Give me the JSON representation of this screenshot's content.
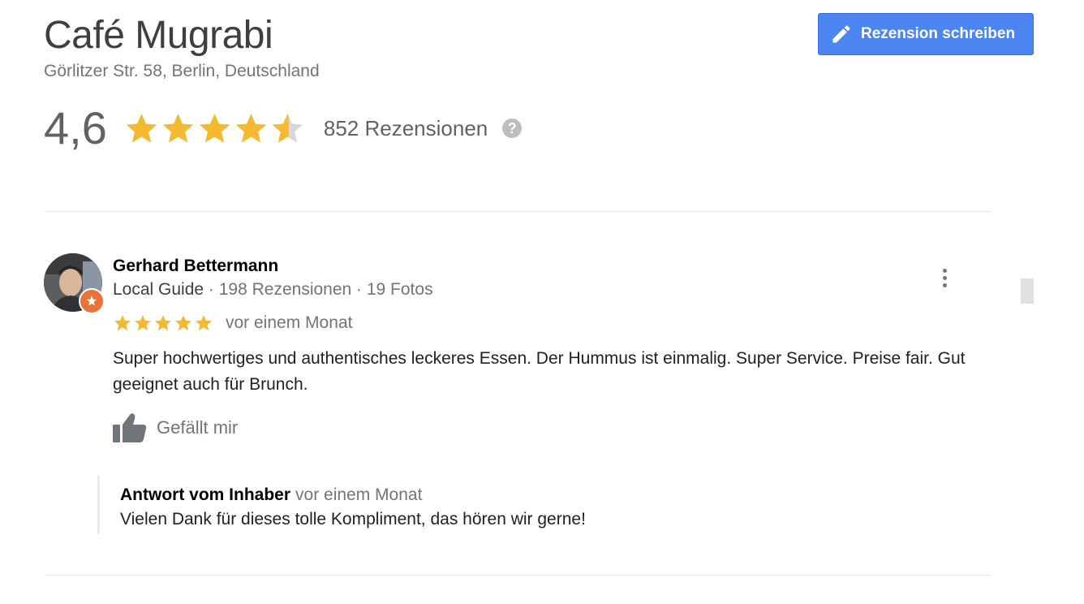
{
  "place": {
    "name": "Café Mugrabi",
    "address": "Görlitzer Str. 58, Berlin, Deutschland"
  },
  "actions": {
    "write_review_label": "Rezension schreiben",
    "write_review_icon": "pencil-icon"
  },
  "summary": {
    "rating": "4,6",
    "rating_value": 4.6,
    "stars_max": 5,
    "review_count": "852 Rezensionen",
    "help_icon": "question-circle-icon",
    "help_glyph": "?"
  },
  "reviews": [
    {
      "author": "Gerhard Bettermann",
      "guide_label": "Local Guide",
      "meta": " · 198 Rezensionen · 19 Fotos",
      "stars": 5,
      "date": "vor einem Monat",
      "text": "Super hochwertiges und authentisches leckeres Essen. Der Hummus ist einmalig. Super Service. Preise fair. Gut geeignet auch für Brunch.",
      "like_label": "Gefällt mir",
      "owner_reply": {
        "title": "Antwort vom Inhaber",
        "date": "vor einem Monat",
        "text": "Vielen Dank für dieses tolle Kompliment, das hören wir gerne!"
      }
    }
  ],
  "colors": {
    "star_filled": "#f4b92f",
    "star_empty": "#d8d8d8",
    "button_bg": "#4c84f0",
    "badge": "#e8743b"
  }
}
